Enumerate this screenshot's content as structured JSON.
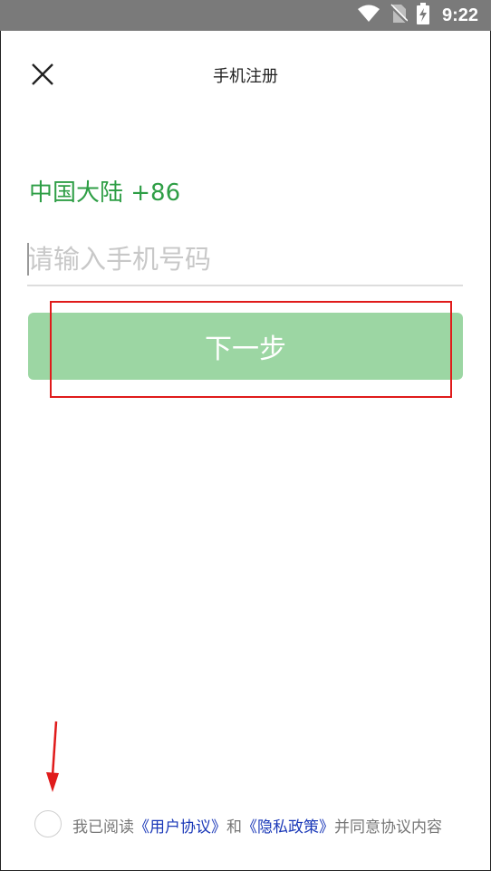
{
  "status_bar": {
    "time": "9:22",
    "icons": [
      "wifi-icon",
      "no-sim-icon",
      "battery-charging-icon"
    ]
  },
  "header": {
    "title": "手机注册",
    "close_icon": "close-icon"
  },
  "form": {
    "region": "中国大陆 +86",
    "phone_placeholder": "请输入手机号码",
    "phone_value": "",
    "next_label": "下一步"
  },
  "agreement": {
    "prefix": "我已阅读",
    "user_agreement": "《用户协议》",
    "and": "和",
    "privacy_policy": "《隐私政策》",
    "suffix": "并同意协议内容",
    "checked": false
  },
  "colors": {
    "accent_green": "#2e9e45",
    "button_green_disabled": "#9cd6a3",
    "link_blue": "#1a38b8",
    "annotation_red": "#e01b1b",
    "status_bar": "#7a7a7a"
  }
}
